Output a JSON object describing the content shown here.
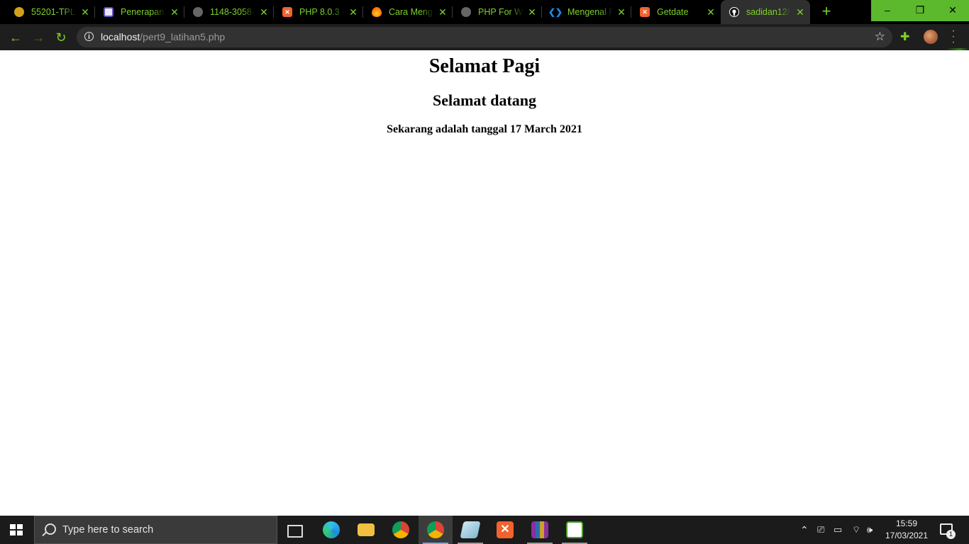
{
  "tabs": [
    {
      "title": "55201-TPLC",
      "icon": "gold-coin-icon",
      "color": "#d4a017"
    },
    {
      "title": "Penerapan I",
      "icon": "purple-app-icon",
      "color": "#6a4fc3"
    },
    {
      "title": "1148-3058-",
      "icon": "globe-icon",
      "color": "#777777"
    },
    {
      "title": "PHP 8.0.3 -",
      "icon": "xampp-icon",
      "color": "#f2622e"
    },
    {
      "title": "Cara Meng",
      "icon": "flame-icon",
      "color": "#ff6d00"
    },
    {
      "title": "PHP For Wi",
      "icon": "globe-icon",
      "color": "#777777"
    },
    {
      "title": "Mengenal F",
      "icon": "diamond-code-icon",
      "color": "#1e88e5"
    },
    {
      "title": "Getdate",
      "icon": "xampp-icon",
      "color": "#f2622e"
    },
    {
      "title": "sadidan12/",
      "icon": "github-icon",
      "color": "#ffffff"
    }
  ],
  "address_bar": {
    "host": "localhost",
    "path": "/pert9_latihan5.php"
  },
  "page": {
    "heading": "Selamat Pagi",
    "subheading": "Selamat datang",
    "date_line": "Sekarang adalah tanggal 17 March 2021"
  },
  "taskbar": {
    "search_placeholder": "Type here to search",
    "time": "15:59",
    "date": "17/03/2021",
    "notification_count": "1"
  },
  "colors": {
    "accent": "#7cd12a",
    "window_controls": "#5cb82d"
  }
}
